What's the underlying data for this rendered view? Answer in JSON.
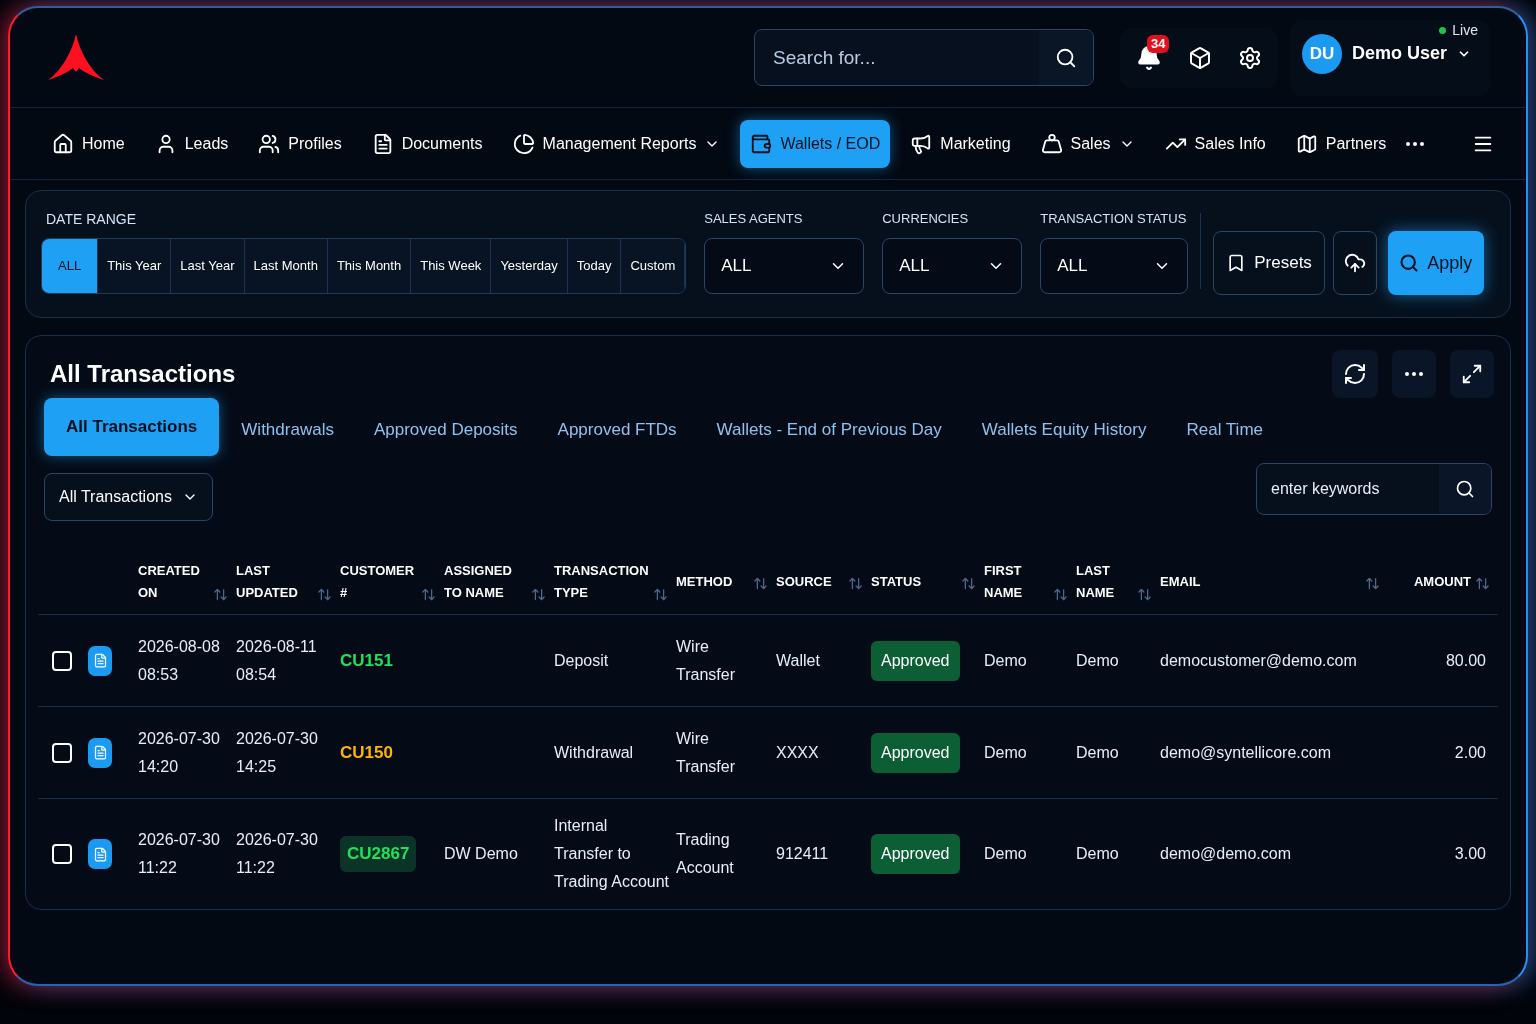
{
  "search": {
    "placeholder": "Search for..."
  },
  "notifications": {
    "count": "34"
  },
  "status": {
    "label": "Live",
    "online": true
  },
  "user": {
    "initials": "DU",
    "name": "Demo User"
  },
  "nav": [
    {
      "label": "Home",
      "selected": false,
      "dropdown": false
    },
    {
      "label": "Leads",
      "selected": false,
      "dropdown": false
    },
    {
      "label": "Profiles",
      "selected": false,
      "dropdown": false
    },
    {
      "label": "Documents",
      "selected": false,
      "dropdown": false
    },
    {
      "label": "Management Reports",
      "selected": false,
      "dropdown": true
    },
    {
      "label": "Wallets / EOD",
      "selected": true,
      "dropdown": false
    },
    {
      "label": "Marketing",
      "selected": false,
      "dropdown": false
    },
    {
      "label": "Sales",
      "selected": false,
      "dropdown": true
    },
    {
      "label": "Sales Info",
      "selected": false,
      "dropdown": false
    },
    {
      "label": "Partners",
      "selected": false,
      "dropdown": false
    }
  ],
  "filters": {
    "date_range": {
      "label": "DATE RANGE",
      "options": [
        {
          "label": "ALL",
          "selected": true
        },
        {
          "label": "This Year",
          "selected": false
        },
        {
          "label": "Last Year",
          "selected": false
        },
        {
          "label": "Last Month",
          "selected": false
        },
        {
          "label": "This Month",
          "selected": false
        },
        {
          "label": "This Week",
          "selected": false
        },
        {
          "label": "Yesterday",
          "selected": false
        },
        {
          "label": "Today",
          "selected": false
        },
        {
          "label": "Custom",
          "selected": false
        }
      ]
    },
    "selects": [
      {
        "label": "SALES AGENTS",
        "value": "ALL"
      },
      {
        "label": "CURRENCIES",
        "value": "ALL"
      },
      {
        "label": "TRANSACTION STATUS",
        "value": "ALL"
      }
    ],
    "presets": "Presets",
    "apply": "Apply"
  },
  "panel": {
    "title": "All Transactions",
    "tabs": [
      {
        "label": "All Transactions",
        "selected": true
      },
      {
        "label": "Withdrawals",
        "selected": false
      },
      {
        "label": "Approved Deposits",
        "selected": false
      },
      {
        "label": "Approved FTDs",
        "selected": false
      },
      {
        "label": "Wallets - End of Previous Day",
        "selected": false
      },
      {
        "label": "Wallets Equity History",
        "selected": false
      },
      {
        "label": "Real Time",
        "selected": false
      }
    ],
    "view": "All Transactions",
    "keywords": {
      "placeholder": "enter keywords"
    },
    "table": {
      "columns": [
        "CREATED ON",
        "LAST UPDATED",
        "CUSTOMER #",
        "ASSIGNED TO NAME",
        "TRANSACTION TYPE",
        "METHOD",
        "SOURCE",
        "STATUS",
        "FIRST NAME",
        "LAST NAME",
        "EMAIL",
        "AMOUNT"
      ],
      "rows": [
        {
          "checked": false,
          "created": "2026-08-08 08:53",
          "updated": "2026-08-11 08:54",
          "customer": {
            "code": "CU151",
            "color": "#22e05a",
            "highlighted": false
          },
          "assigned": "",
          "type": "Deposit",
          "method": "Wire Transfer",
          "source": "Wallet",
          "status": "Approved",
          "first_name": "Demo",
          "last_name": "Demo",
          "email": "democustomer@demo.com",
          "amount": "80.00"
        },
        {
          "checked": false,
          "created": "2026-07-30 14:20",
          "updated": "2026-07-30 14:25",
          "customer": {
            "code": "CU150",
            "color": "#ffb400",
            "highlighted": false
          },
          "assigned": "",
          "type": "Withdrawal",
          "method": "Wire Transfer",
          "source": "XXXX",
          "status": "Approved",
          "first_name": "Demo",
          "last_name": "Demo",
          "email": "demo@syntellicore.com",
          "amount": "2.00"
        },
        {
          "checked": false,
          "created": "2026-07-30 11:22",
          "updated": "2026-07-30 11:22",
          "customer": {
            "code": "CU2867",
            "color": "#22e05a",
            "highlighted": true
          },
          "assigned": "DW Demo",
          "type": "Internal Transfer to Trading Account",
          "method": "Trading Account",
          "source": "912411",
          "status": "Approved",
          "first_name": "Demo",
          "last_name": "Demo",
          "email": "demo@demo.com",
          "amount": "3.00"
        }
      ]
    }
  }
}
